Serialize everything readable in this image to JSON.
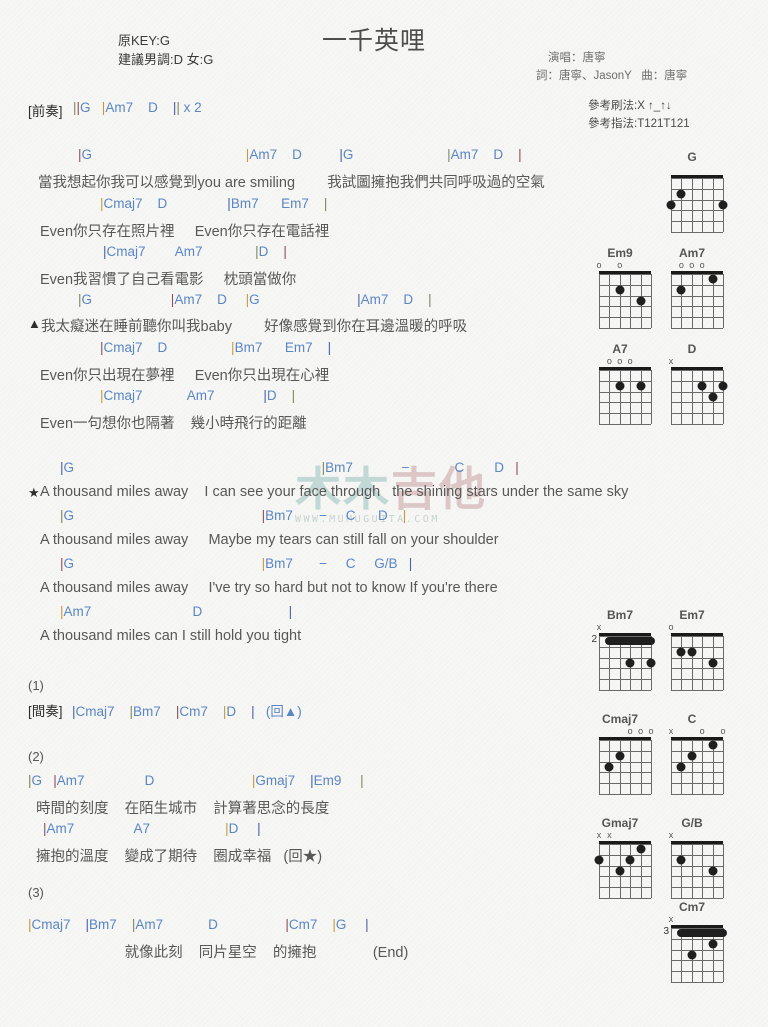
{
  "header": {
    "key_label": "原KEY:G",
    "suggest_label": "建議男調:D 女:G",
    "title": "一千英哩",
    "singer": "演唱：唐寧",
    "writer": "詞：唐寧、JasonY   曲：唐寧",
    "strum": "參考刷法:X ↑_↑↓",
    "finger": "參考指法:T121T121"
  },
  "watermark": {
    "char1": "木木",
    "char2": "吉他",
    "url": "WWW.MUMUGUITA.COM"
  },
  "intro": {
    "label": "[前奏]",
    "bars": "||G   |Am7    D    || x 2"
  },
  "sections": {
    "verse1": {
      "l1_chords": "|G                                         |Am7    D          |G                         |Am7    D    |",
      "l1_lyric": "當我想起你我可以感覺到you are smiling        我試圖擁抱我們共同呼吸過的空氣",
      "l2_chords": "|Cmaj7    D                |Bm7      Em7    |",
      "l2_lyric": "Even你只存在照片裡     Even你只存在電話裡",
      "l3_chords": "|Cmaj7        Am7              |D    |",
      "l3_lyric": "Even我習慣了自己看電影     枕頭當做你"
    },
    "verse2": {
      "marker": "▲",
      "l1_chords": "|G                     |Am7    D     |G                          |Am7    D    |",
      "l1_lyric": "我太癡迷在睡前聽你叫我baby        好像感覺到你在耳邊溫暖的呼吸",
      "l2_chords": "|Cmaj7    D                 |Bm7      Em7    |",
      "l2_lyric": "Even你只出現在夢裡     Even你只出現在心裡",
      "l3_chords": "|Cmaj7            Am7             |D    |",
      "l3_lyric": "Even一句想你也隔著    幾小時飛行的距離"
    },
    "chorus": {
      "marker": "★",
      "l1_chords": "|G                                                                  |Bm7             −            C        D   |",
      "l1_lyric": "A thousand miles away    I can see your face through   the shining stars under the same sky",
      "l2_chords": "|G                                                  |Bm7       −     C      D    |",
      "l2_lyric": "A thousand miles away     Maybe my tears can still fall on your shoulder",
      "l3_chords": "|G                                                  |Bm7       −     C     G/B   |",
      "l3_lyric": "A thousand miles away     I've try so hard but not to know If you're there",
      "l4_chords": "|Am7                           D                       |",
      "l4_lyric": "A thousand miles can I still hold you tight"
    },
    "part1": {
      "number": "(1)",
      "label": "[間奏]",
      "bars": "|Cmaj7    |Bm7    |Cm7    |D    |   (回▲)"
    },
    "part2": {
      "number": "(2)",
      "l1_chords": "|G   |Am7                D                          |Gmaj7    |Em9     |",
      "l1_lyric": "  時間的刻度    在陌生城市    計算著思念的長度",
      "l2_chords": "    |Am7                A7                    |D     |",
      "l2_lyric": "  擁抱的溫度    變成了期待    圈成幸福   (回★)"
    },
    "part3": {
      "number": "(3)",
      "l1_chords": "|Cmaj7    |Bm7    |Am7            D                  |Cm7    |G     |",
      "l1_lyric": "                        就像此刻    同片星空    的擁抱              (End)"
    }
  },
  "diagrams": [
    {
      "name": "G",
      "top": [
        "",
        "",
        "",
        "",
        "",
        ""
      ],
      "dots": [
        [
          6,
          3
        ],
        [
          5,
          2
        ],
        [
          1,
          3
        ]
      ],
      "barre": null,
      "fret": ""
    },
    {
      "name": "Em9",
      "top": [
        "o",
        "",
        "o",
        "",
        "",
        ""
      ],
      "dots": [
        [
          4,
          2
        ],
        [
          2,
          3
        ]
      ],
      "barre": null,
      "fret": ""
    },
    {
      "name": "Am7",
      "top": [
        "",
        "o",
        "o",
        "o",
        "",
        ""
      ],
      "dots": [
        [
          5,
          2
        ],
        [
          2,
          1
        ]
      ],
      "barre": null,
      "fret": ""
    },
    {
      "name": "A7",
      "top": [
        "",
        "o",
        "o",
        "o",
        "",
        ""
      ],
      "dots": [
        [
          4,
          2
        ],
        [
          2,
          2
        ]
      ],
      "barre": null,
      "fret": ""
    },
    {
      "name": "D",
      "top": [
        "x",
        "",
        "",
        "",
        "",
        ""
      ],
      "dots": [
        [
          3,
          2
        ],
        [
          2,
          3
        ],
        [
          1,
          2
        ]
      ],
      "barre": null,
      "fret": ""
    },
    {
      "name": "Bm7",
      "top": [
        "x",
        "",
        "",
        "",
        "",
        ""
      ],
      "dots": [
        [
          3,
          3
        ],
        [
          1,
          3
        ]
      ],
      "barre": 2,
      "fret": "2"
    },
    {
      "name": "Em7",
      "top": [
        "o",
        "",
        "",
        "",
        "",
        ""
      ],
      "dots": [
        [
          5,
          2
        ],
        [
          4,
          2
        ],
        [
          2,
          3
        ]
      ],
      "barre": null,
      "fret": ""
    },
    {
      "name": "Cmaj7",
      "top": [
        "",
        "",
        "",
        "o",
        "o",
        "o"
      ],
      "dots": [
        [
          5,
          3
        ],
        [
          4,
          2
        ]
      ],
      "barre": null,
      "fret": ""
    },
    {
      "name": "C",
      "top": [
        "x",
        "",
        "",
        "o",
        "",
        "o"
      ],
      "dots": [
        [
          5,
          3
        ],
        [
          4,
          2
        ],
        [
          2,
          1
        ]
      ],
      "barre": null,
      "fret": ""
    },
    {
      "name": "Gmaj7",
      "top": [
        "x",
        "x",
        "",
        "",
        "",
        ""
      ],
      "dots": [
        [
          6,
          2
        ],
        [
          4,
          3
        ],
        [
          3,
          2
        ],
        [
          2,
          1
        ]
      ],
      "barre": null,
      "fret": ""
    },
    {
      "name": "G/B",
      "top": [
        "x",
        "",
        "",
        "",
        "",
        ""
      ],
      "dots": [
        [
          5,
          2
        ],
        [
          2,
          3
        ]
      ],
      "barre": null,
      "fret": ""
    },
    {
      "name": "Cm7",
      "top": [
        "x",
        "",
        "",
        "",
        "",
        ""
      ],
      "dots": [
        [
          4,
          3
        ],
        [
          2,
          2
        ]
      ],
      "barre": 2,
      "fret": "3"
    }
  ]
}
